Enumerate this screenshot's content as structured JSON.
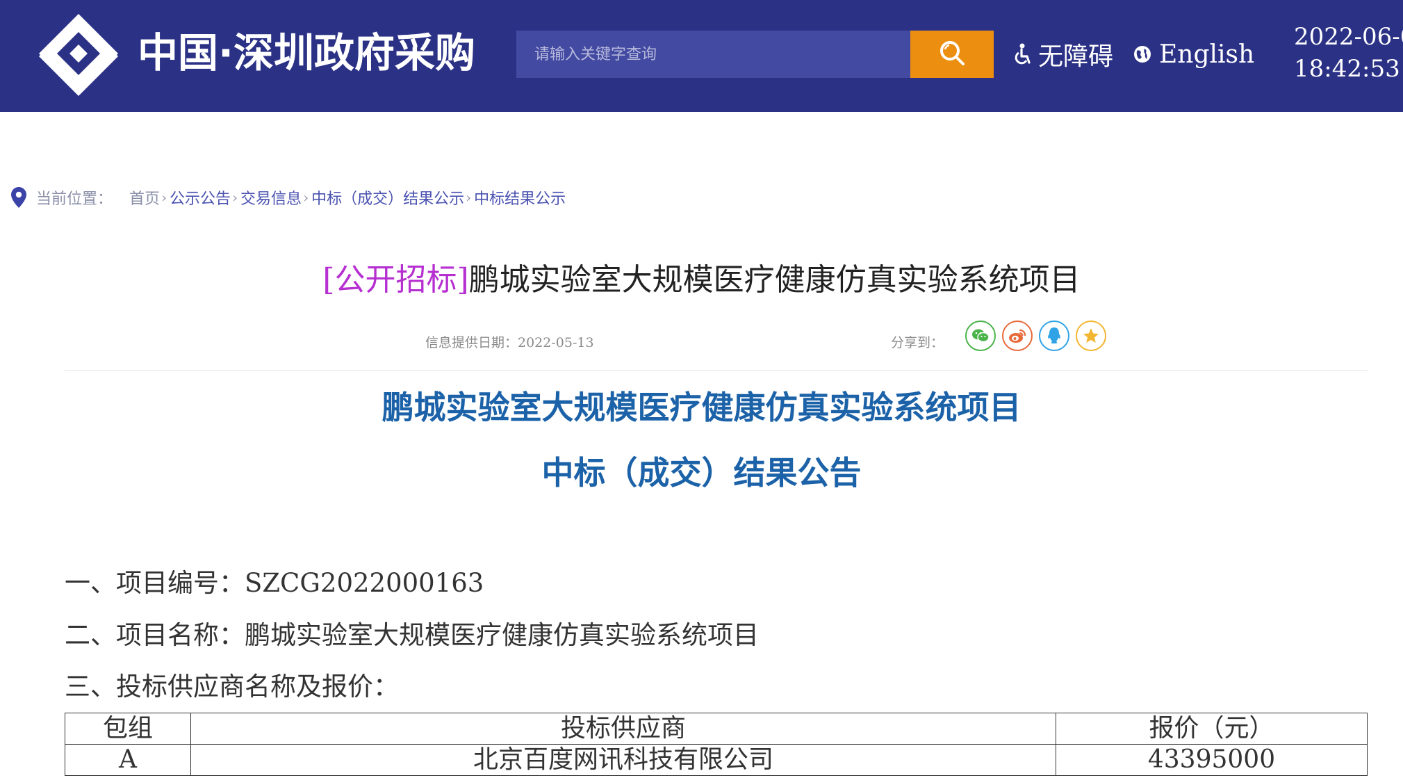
{
  "header": {
    "site_title": "中国·深圳政府采购",
    "search_placeholder": "请输入关键字查询",
    "accessibility_label": "无障碍",
    "english_label": "English",
    "date": "2022-06-0",
    "time": "18:42:53"
  },
  "breadcrumb": {
    "label": "当前位置：",
    "items": [
      "首页",
      "公示公告",
      "交易信息",
      "中标（成交）结果公示",
      "中标结果公示"
    ]
  },
  "article": {
    "tag": "[公开招标]",
    "title": "鹏城实验室大规模医疗健康仿真实验系统项目",
    "date_text": "信息提供日期：2022-05-13",
    "share_label": "分享到：",
    "share_icons": [
      "wechat-icon",
      "weibo-icon",
      "qq-icon",
      "favorite-icon"
    ]
  },
  "notice": {
    "heading": "鹏城实验室大规模医疗健康仿真实验系统项目",
    "subheading": "中标（成交）结果公告",
    "line1": "一、项目编号：SZCG2022000163",
    "line2": "二、项目名称：鹏城实验室大规模医疗健康仿真实验系统项目",
    "line3": "三、投标供应商名称及报价："
  },
  "table": {
    "headers": [
      "包组",
      "投标供应商",
      "报价（元）"
    ],
    "rows": [
      {
        "group": "A",
        "supplier": "北京百度网讯科技有限公司",
        "price": "43395000"
      }
    ]
  },
  "colors": {
    "header_bg": "#2b3185",
    "search_btn": "#ec8f10",
    "heading_blue": "#1c62a8",
    "tag_purple": "#b62fd1"
  }
}
